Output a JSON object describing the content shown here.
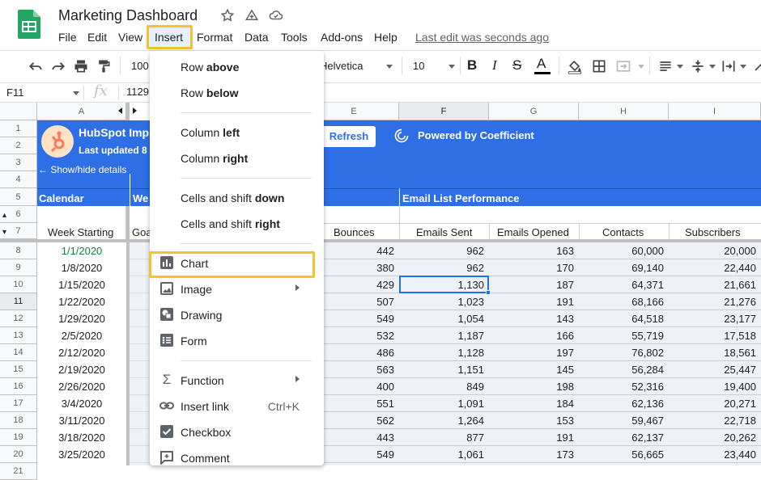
{
  "app": {
    "title": "Marketing Dashboard",
    "last_edit": "Last edit was seconds ago"
  },
  "menubar": [
    "File",
    "Edit",
    "View",
    "Insert",
    "Format",
    "Data",
    "Tools",
    "Add-ons",
    "Help"
  ],
  "toolbar": {
    "zoom": "100",
    "font": "Helvetica",
    "font_size": "10"
  },
  "formula": {
    "cell_ref": "F11",
    "value": "1129"
  },
  "columns": [
    "A",
    "E",
    "F",
    "G",
    "H",
    "I"
  ],
  "rows": [
    "1",
    "2",
    "3",
    "4",
    "5",
    "6",
    "7",
    "8",
    "9",
    "10",
    "11",
    "12",
    "13",
    "14",
    "15",
    "16",
    "17",
    "18",
    "19",
    "20",
    "21"
  ],
  "banner": {
    "title": "HubSpot Imp",
    "subtitle": "Last updated 8",
    "show_hide": "← Show/hide details",
    "refresh": "Refresh",
    "powered": "Powered by Coefficient",
    "color": "#2e6fe6"
  },
  "sections": {
    "calendar": "Calendar",
    "weekly": "We",
    "email": "Email List Performance"
  },
  "headers": {
    "week": "Week Starting",
    "goals": "Goa",
    "bounces": "Bounces",
    "sent": "Emails Sent",
    "opened": "Emails Opened",
    "contacts": "Contacts",
    "subscribers": "Subscribers"
  },
  "table": [
    {
      "week": "1/1/2020",
      "bounces": "442",
      "sent": "962",
      "opened": "163",
      "contacts": "60,000",
      "subs": "20,000"
    },
    {
      "week": "1/8/2020",
      "bounces": "380",
      "sent": "962",
      "opened": "170",
      "contacts": "69,140",
      "subs": "22,440"
    },
    {
      "week": "1/15/2020",
      "bounces": "429",
      "sent": "1,130",
      "opened": "187",
      "contacts": "64,371",
      "subs": "21,661"
    },
    {
      "week": "1/22/2020",
      "bounces": "507",
      "sent": "1,023",
      "opened": "191",
      "contacts": "68,166",
      "subs": "21,276"
    },
    {
      "week": "1/29/2020",
      "bounces": "549",
      "sent": "1,054",
      "opened": "143",
      "contacts": "64,518",
      "subs": "23,177"
    },
    {
      "week": "2/5/2020",
      "bounces": "532",
      "sent": "1,187",
      "opened": "166",
      "contacts": "55,719",
      "subs": "17,518"
    },
    {
      "week": "2/12/2020",
      "bounces": "486",
      "sent": "1,128",
      "opened": "197",
      "contacts": "76,802",
      "subs": "18,561"
    },
    {
      "week": "2/19/2020",
      "bounces": "563",
      "sent": "1,151",
      "opened": "145",
      "contacts": "56,284",
      "subs": "25,447"
    },
    {
      "week": "2/26/2020",
      "bounces": "400",
      "sent": "849",
      "opened": "198",
      "contacts": "52,316",
      "subs": "19,400"
    },
    {
      "week": "3/4/2020",
      "bounces": "551",
      "sent": "1,091",
      "opened": "184",
      "contacts": "62,136",
      "subs": "20,271"
    },
    {
      "week": "3/11/2020",
      "bounces": "562",
      "sent": "1,264",
      "opened": "153",
      "contacts": "59,467",
      "subs": "22,718"
    },
    {
      "week": "3/18/2020",
      "bounces": "443",
      "sent": "877",
      "opened": "191",
      "contacts": "62,137",
      "subs": "20,262"
    },
    {
      "week": "3/25/2020",
      "bounces": "549",
      "sent": "1,061",
      "opened": "173",
      "contacts": "56,665",
      "subs": "23,440"
    }
  ],
  "insert_menu": {
    "row_above": {
      "a": "Row ",
      "b": "above"
    },
    "row_below": {
      "a": "Row ",
      "b": "below"
    },
    "col_left": {
      "a": "Column ",
      "b": "left"
    },
    "col_right": {
      "a": "Column ",
      "b": "right"
    },
    "shift_down": {
      "a": "Cells and shift ",
      "b": "down"
    },
    "shift_right": {
      "a": "Cells and shift ",
      "b": "right"
    },
    "chart": "Chart",
    "image": "Image",
    "drawing": "Drawing",
    "form": "Form",
    "function": "Function",
    "link": "Insert link",
    "link_shortcut": "Ctrl+K",
    "checkbox": "Checkbox",
    "comment": "Comment"
  },
  "colors": {
    "highlight": "#f1c232",
    "accent": "#1a73e8",
    "green_text": "#188038"
  }
}
